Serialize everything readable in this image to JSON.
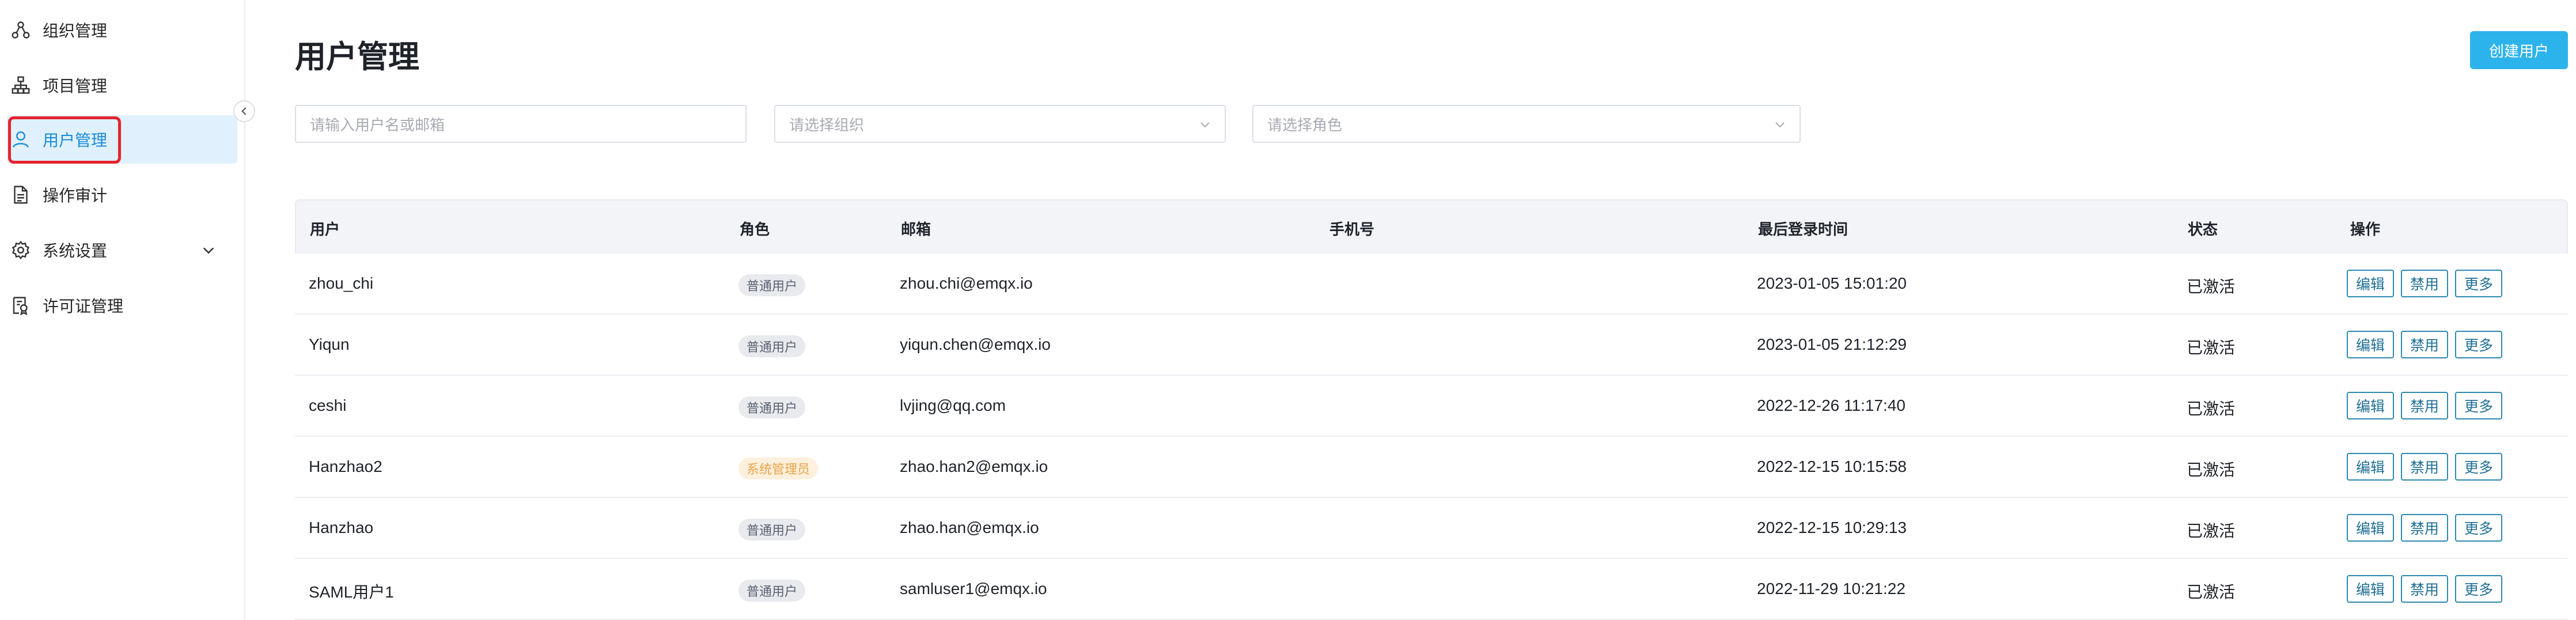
{
  "sidebar": {
    "items": [
      {
        "label": "组织管理",
        "icon": "org-icon"
      },
      {
        "label": "项目管理",
        "icon": "project-tree-icon"
      },
      {
        "label": "用户管理",
        "icon": "user-icon",
        "active": true
      },
      {
        "label": "操作审计",
        "icon": "document-icon"
      },
      {
        "label": "系统设置",
        "icon": "gear-icon",
        "has_submenu": true
      },
      {
        "label": "许可证管理",
        "icon": "license-icon"
      }
    ]
  },
  "header": {
    "title": "用户管理",
    "create_label": "创建用户"
  },
  "filters": {
    "search_placeholder": "请输入用户名或邮箱",
    "org_placeholder": "请选择组织",
    "role_placeholder": "请选择角色"
  },
  "table": {
    "columns": [
      "用户",
      "角色",
      "邮箱",
      "手机号",
      "最后登录时间",
      "状态",
      "操作"
    ],
    "actions": {
      "edit": "编辑",
      "disable": "禁用",
      "more": "更多"
    },
    "rows": [
      {
        "user": "zhou_chi",
        "role": "普通用户",
        "role_type": "normal",
        "email": "zhou.chi@emqx.io",
        "phone": "",
        "last_login": "2023-01-05 15:01:20",
        "status": "已激活"
      },
      {
        "user": "Yiqun",
        "role": "普通用户",
        "role_type": "normal",
        "email": "yiqun.chen@emqx.io",
        "phone": "",
        "last_login": "2023-01-05 21:12:29",
        "status": "已激活"
      },
      {
        "user": "ceshi",
        "role": "普通用户",
        "role_type": "normal",
        "email": "lvjing@qq.com",
        "phone": "",
        "last_login": "2022-12-26 11:17:40",
        "status": "已激活"
      },
      {
        "user": "Hanzhao2",
        "role": "系统管理员",
        "role_type": "admin",
        "email": "zhao.han2@emqx.io",
        "phone": "",
        "last_login": "2022-12-15 10:15:58",
        "status": "已激活"
      },
      {
        "user": "Hanzhao",
        "role": "普通用户",
        "role_type": "normal",
        "email": "zhao.han@emqx.io",
        "phone": "",
        "last_login": "2022-12-15 10:29:13",
        "status": "已激活"
      },
      {
        "user": "SAML用户1",
        "role": "普通用户",
        "role_type": "normal",
        "email": "samluser1@emqx.io",
        "phone": "",
        "last_login": "2022-11-29 10:21:22",
        "status": "已激活"
      }
    ]
  },
  "colors": {
    "accent": "#2db3eb",
    "active_bg": "#e0f1fd",
    "highlight_outline": "#e5232d"
  }
}
